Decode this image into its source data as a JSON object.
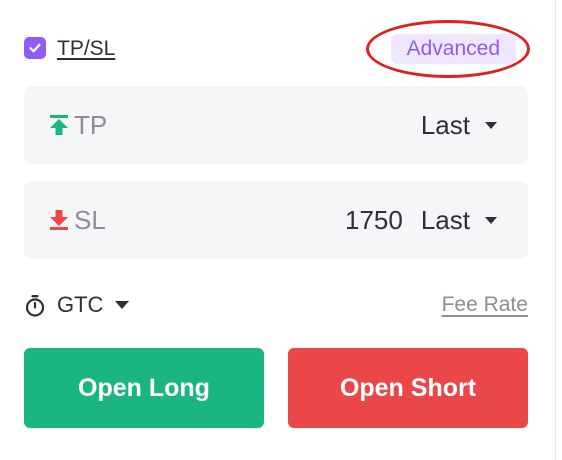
{
  "tpsl": {
    "checked": true,
    "label": "TP/SL",
    "advanced_label": "Advanced"
  },
  "take_profit": {
    "label": "TP",
    "value": "",
    "trigger_type": "Last",
    "icon": "arrow-up-to-line-icon",
    "icon_color": "#1bb680"
  },
  "stop_loss": {
    "label": "SL",
    "value": "1750",
    "trigger_type": "Last",
    "icon": "arrow-down-to-line-icon",
    "icon_color": "#ea4848"
  },
  "time_in_force": {
    "label": "GTC",
    "icon": "timer-icon"
  },
  "fee_rate_label": "Fee Rate",
  "buttons": {
    "open_long": "Open Long",
    "open_short": "Open Short"
  },
  "colors": {
    "accent": "#8e5cf6",
    "long": "#1bb680",
    "short": "#ea4848",
    "highlight": "#e02020"
  }
}
